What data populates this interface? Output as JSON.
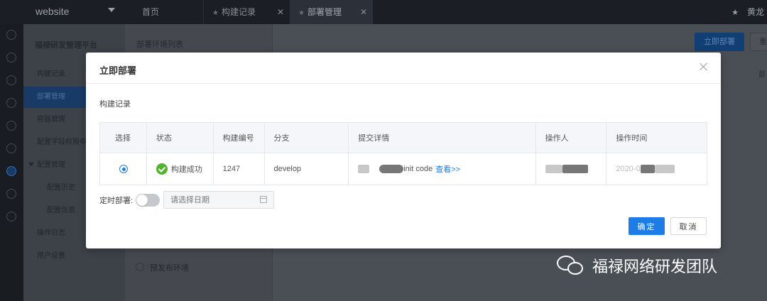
{
  "app": {
    "logo": "website",
    "platform_title": "福禄研发管理平台",
    "user_name": "黄龙"
  },
  "tabs": [
    {
      "label": "首页"
    },
    {
      "label": "构建记录"
    },
    {
      "label": "部署管理"
    }
  ],
  "sidebar": {
    "items": [
      {
        "label": "构建记录"
      },
      {
        "label": "部署管理"
      },
      {
        "label": "容器管理"
      },
      {
        "label": "配置字段权限申"
      },
      {
        "label": "配置管理"
      },
      {
        "label": "配置历史"
      },
      {
        "label": "配置信息"
      },
      {
        "label": "操作日志"
      },
      {
        "label": "用户设置"
      }
    ]
  },
  "panel": {
    "title": "部署环境列表",
    "env_option": "预发布环境"
  },
  "main": {
    "deploy_now_button": "立即部署",
    "reset_button": "重",
    "column_partial": "部"
  },
  "modal": {
    "title": "立即部署",
    "section_label": "构建记录",
    "columns": [
      "选择",
      "状态",
      "构建编号",
      "分支",
      "提交详情",
      "操作人",
      "操作时间"
    ],
    "row": {
      "status": "构建成功",
      "build_no": "1247",
      "branch": "develop",
      "commit": "init code",
      "view_link": "查看>>",
      "time_partial": "2020-0"
    },
    "schedule_label": "定时部署:",
    "date_placeholder": "请选择日期",
    "ok_button": "确定",
    "cancel_button": "取消"
  },
  "watermark": "福禄网络研发团队",
  "colors": {
    "primary": "#1e7ce6",
    "success": "#52b32e",
    "sidebar_dark": "#1b1f25"
  }
}
